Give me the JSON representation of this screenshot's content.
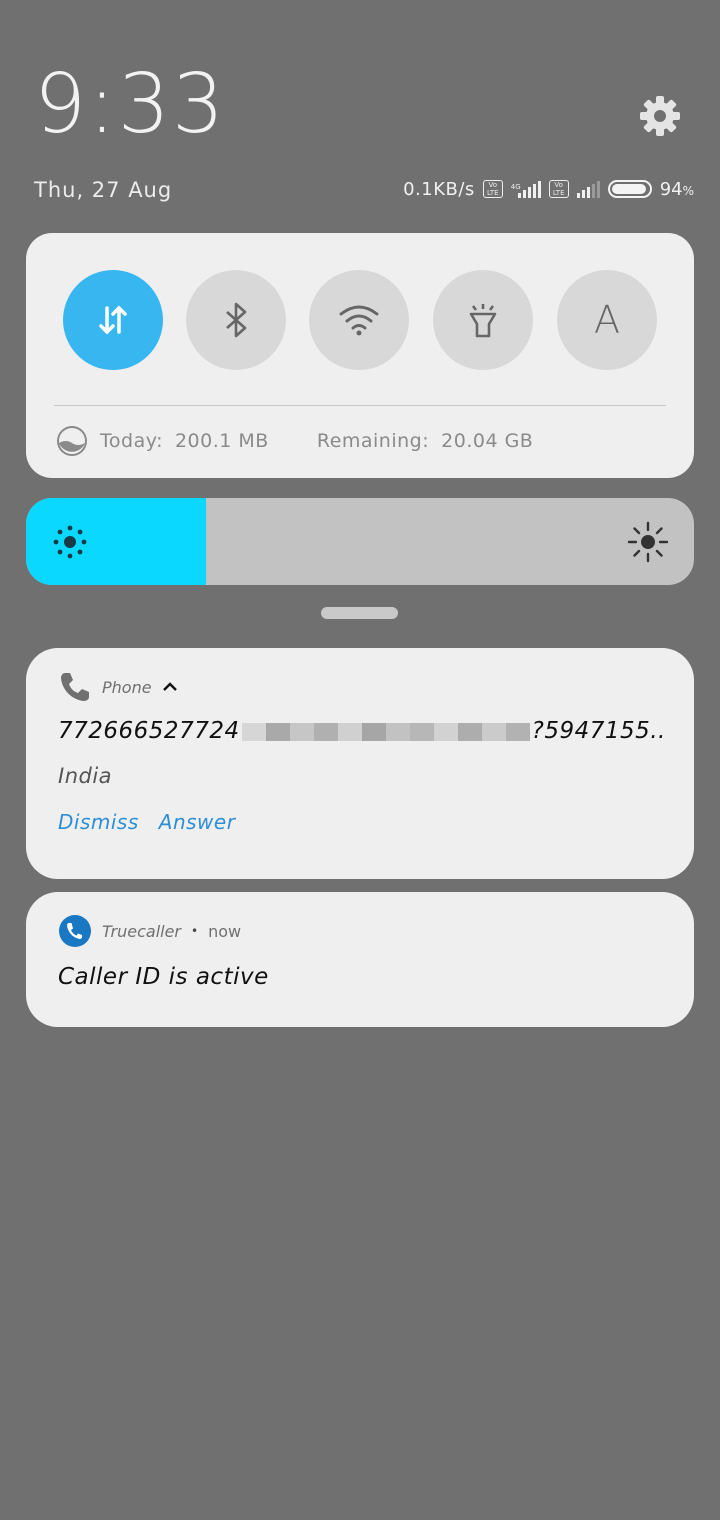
{
  "header": {
    "time": "9:33",
    "date": "Thu, 27 Aug",
    "net_speed": "0.1KB/s",
    "volte1": "Vo LTE",
    "network_gen": "4G",
    "volte2": "Vo LTE",
    "battery_percent": "94",
    "battery_percent_sign": "%",
    "battery_level": 0.94
  },
  "quick_settings": {
    "toggles": [
      {
        "name": "mobile-data",
        "icon": "data-arrows-icon",
        "on": true
      },
      {
        "name": "bluetooth",
        "icon": "bluetooth-icon",
        "on": false
      },
      {
        "name": "wifi",
        "icon": "wifi-icon",
        "on": false
      },
      {
        "name": "flashlight",
        "icon": "flashlight-icon",
        "on": false
      },
      {
        "name": "auto-brightness",
        "icon": "A",
        "on": false
      }
    ],
    "today_label": "Today:",
    "today_value": "200.1 MB",
    "remaining_label": "Remaining:",
    "remaining_value": "20.04 GB"
  },
  "brightness": {
    "level": 0.27
  },
  "notifications": {
    "phone": {
      "app": "Phone",
      "number_start": "772666527724",
      "number_end": "?5947155..",
      "location": "India",
      "dismiss": "Dismiss",
      "answer": "Answer"
    },
    "truecaller": {
      "app": "Truecaller",
      "separator": "•",
      "time": "now",
      "message": "Caller ID is active"
    }
  },
  "colors": {
    "background": "#707070",
    "toggle_on": "#38b6f0",
    "brightness_fill": "#0ad8ff",
    "action_link": "#2d8ed6"
  }
}
